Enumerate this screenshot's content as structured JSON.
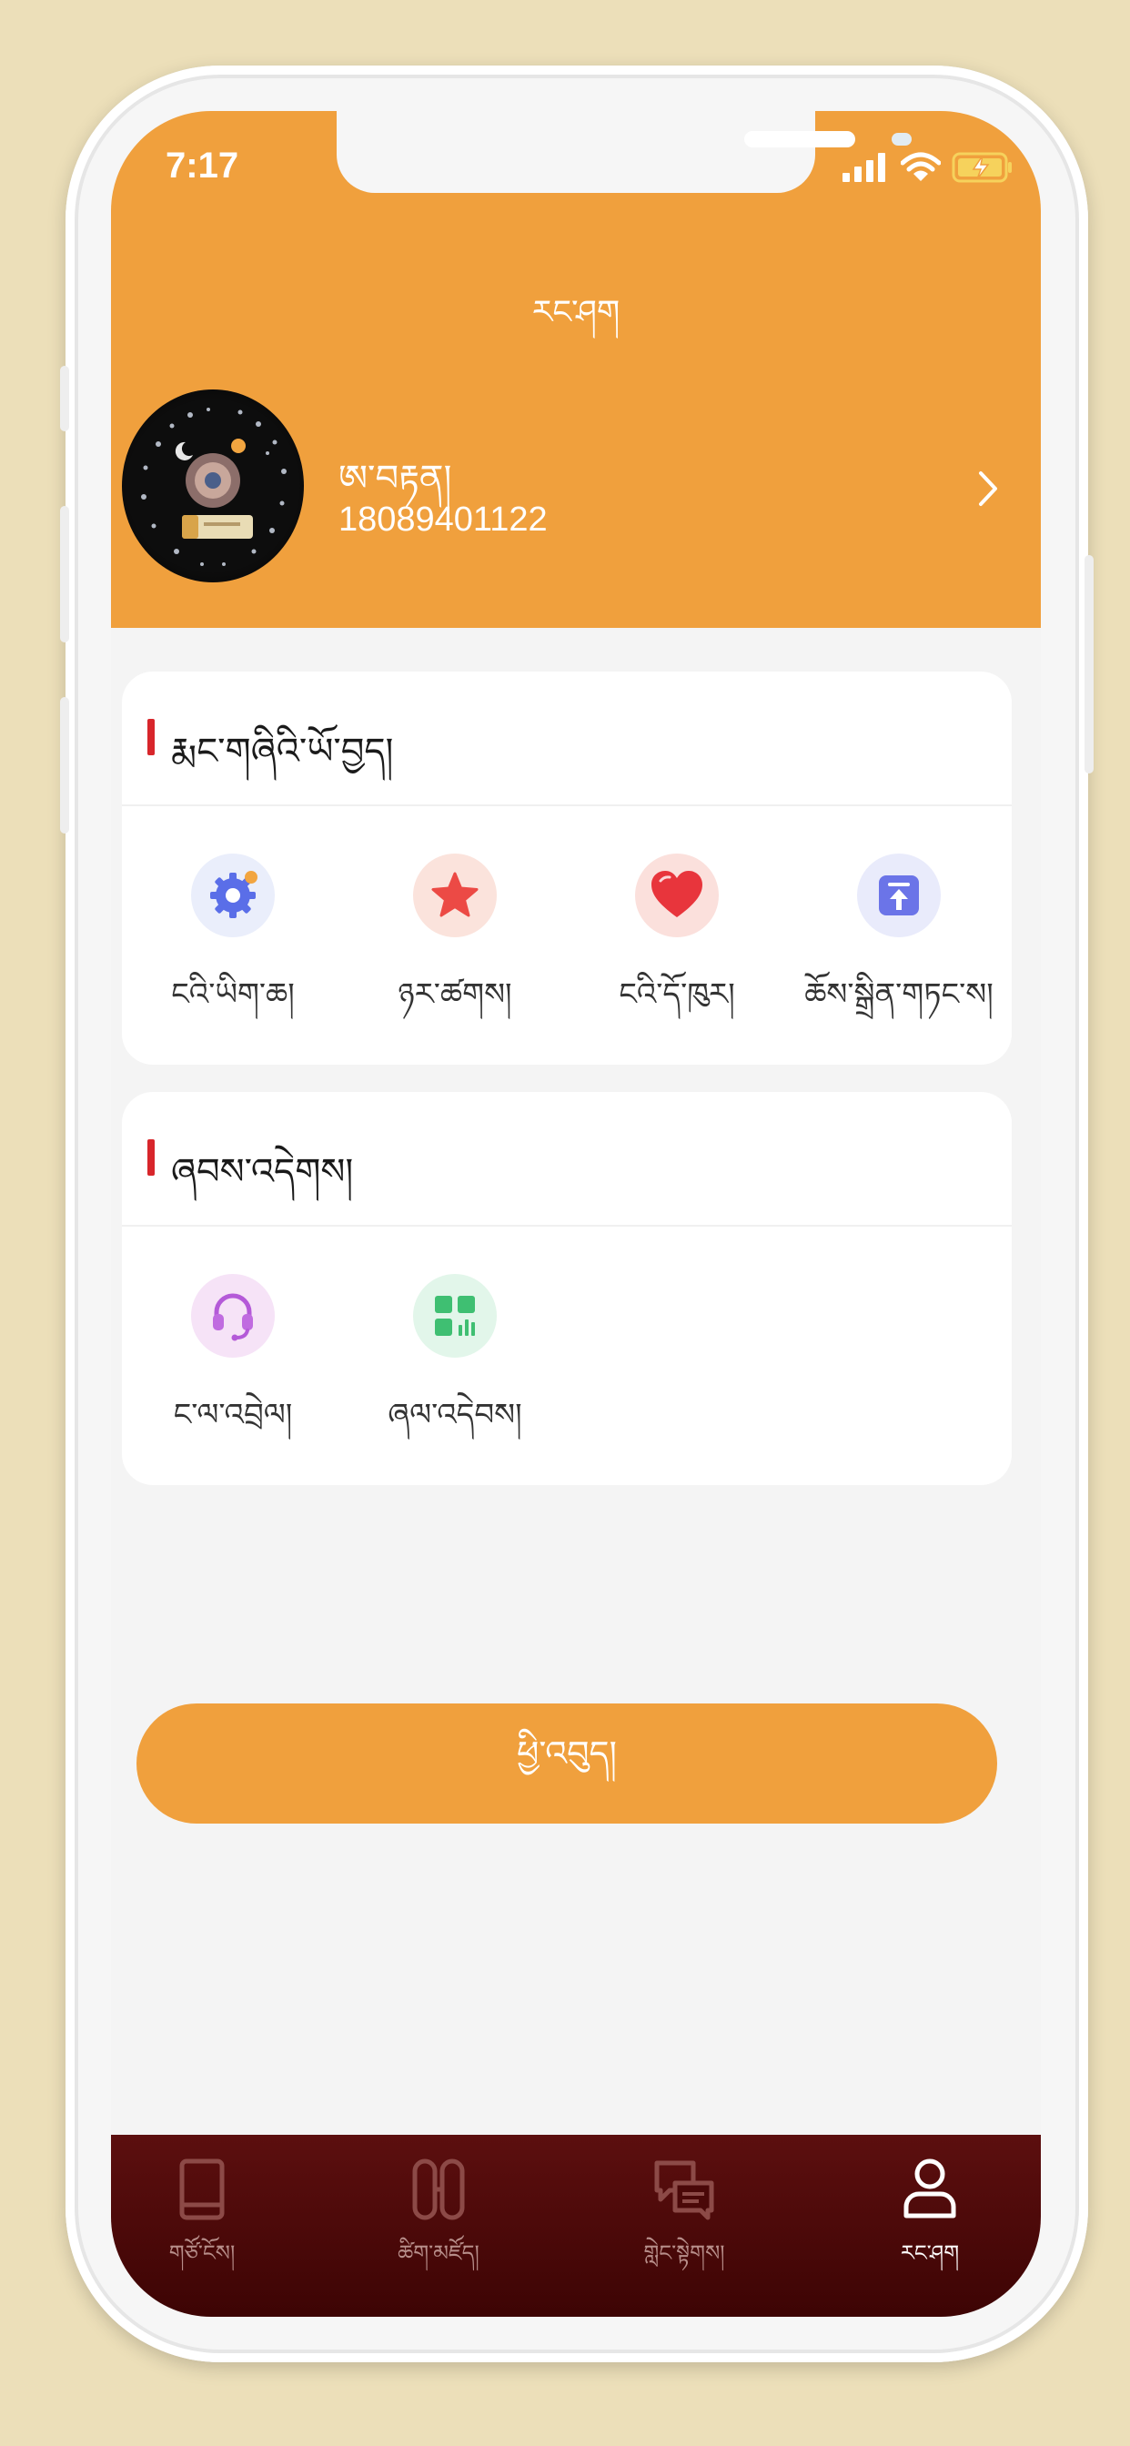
{
  "status_bar": {
    "time": "7:17"
  },
  "header": {
    "title": "རང་ཤག",
    "user_name": "ཨ་བརྟན།",
    "user_phone": "18089401122"
  },
  "sections": [
    {
      "title": "རྨང་གཞིའི་ཡོ་བྱད།",
      "items": [
        {
          "label": "ངའི་ཡིག་ཆ།",
          "icon": "gear-icon"
        },
        {
          "label": "ཉར་ཚགས།",
          "icon": "star-icon"
        },
        {
          "label": "ངའི་དོ་ཁུར།",
          "icon": "heart-icon"
        },
        {
          "label": "ཆོས་སྒྲིན་གཏང་ས།",
          "icon": "upload-icon"
        }
      ]
    },
    {
      "title": "ཞབས་འདེགས།",
      "items": [
        {
          "label": "ང་ལ་འབྲེལ།",
          "icon": "headset-icon"
        },
        {
          "label": "ཞལ་འདེབས།",
          "icon": "apps-chart-icon"
        }
      ]
    }
  ],
  "logout_label": "ཕྱི་འབུད།",
  "tabs": [
    {
      "label": "གཙོ་ངོས།",
      "icon": "book-icon",
      "active": false
    },
    {
      "label": "ཚིག་མཛོད།",
      "icon": "dictionary-icon",
      "active": false
    },
    {
      "label": "གླེང་སྟེགས།",
      "icon": "chat-icon",
      "active": false
    },
    {
      "label": "རང་ཤག",
      "icon": "user-icon",
      "active": true
    }
  ],
  "colors": {
    "accent": "#f0a03d",
    "tabbar": "#4a0808",
    "section_marker": "#d8262b"
  }
}
